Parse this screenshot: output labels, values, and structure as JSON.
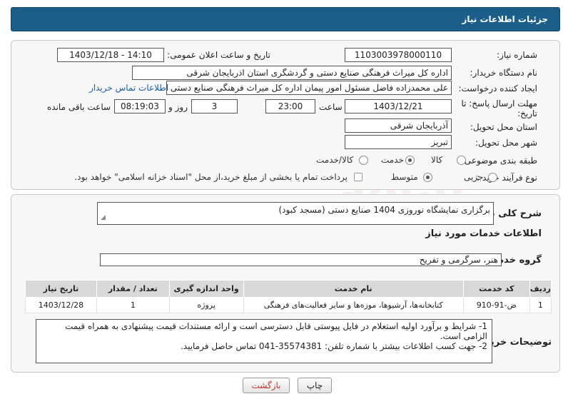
{
  "header": {
    "title": "جزئیات اطلاعات نیاز"
  },
  "fields": {
    "need_number_label": "شماره نیاز:",
    "need_number": "1103003978000110",
    "announce_label": "تاریخ و ساعت اعلان عمومی:",
    "announce_value": "1403/12/18 - 14:10",
    "buyer_label": "نام دستگاه خریدار:",
    "buyer_value": "اداره کل میراث فرهنگی  صنایع دستی و گردشگری استان اذربایجان شرقی",
    "creator_label": "ایجاد کننده درخواست:",
    "creator_value": "علی محمدزاده فاضل مسئول امور پیمان اداره کل میراث فرهنگی  صنایع دستی و",
    "contact_link": "اطلاعات تماس خریدار",
    "deadline_label_1": "مهلت ارسال پاسخ: تا",
    "deadline_label_2": "تاریخ:",
    "deadline_date": "1403/12/21",
    "time_label": "ساعت",
    "deadline_time": "23:00",
    "days_value": "3",
    "days_label": "روز و",
    "remaining_time": "08:19:03",
    "remaining_label": "ساعت باقی مانده",
    "province_label": "استان محل تحویل:",
    "province_value": "آذربایجان شرقی",
    "city_label": "شهر محل تحویل:",
    "city_value": "تبریز",
    "category_label": "طبقه بندی موضوعی:",
    "category_options": [
      "کالا",
      "خدمت",
      "کالا/خدمت"
    ],
    "category_selected": "خدمت",
    "process_label": "نوع فرآیند خرید :",
    "process_options": [
      "جزیی",
      "متوسط"
    ],
    "process_selected": "متوسط",
    "payment_note": "پرداخت تمام یا بخشی از مبلغ خرید،از محل \"اسناد خزانه اسلامی\" خواهد بود."
  },
  "summary": {
    "label": "شرح کلی نیاز:",
    "value": "برگزاری نمایشگاه نوروزی 1404 صنایع دستی (مسجد کبود)"
  },
  "services": {
    "section_title": "اطلاعات خدمات مورد نیاز",
    "group_label": "گروه خدمت:",
    "group_value": "هنر، سرگرمی و تفریح",
    "columns": [
      "ردیف",
      "کد خدمت",
      "نام خدمت",
      "واحد اندازه گیری",
      "تعداد / مقدار",
      "تاریخ نیاز"
    ],
    "rows": [
      [
        "1",
        "ض-91-910",
        "کتابخانه‌ها، آرشیوها، موزه‌ها و سایر فعالیت‌های فرهنگی",
        "پروژه",
        "1",
        "1403/12/28"
      ]
    ]
  },
  "notes": {
    "label": "توضیحات خریدار:",
    "line1": "1- شرایط و برآورد اولیه استعلام در فایل پیوستی قابل دسترسی است و ارائه مستندات قیمت پیشنهادی به همراه قیمت",
    "line2": "الزامی است.",
    "line3": "2- جهت کسب اطلاعات بیشتر  با شماره تلفن: 35574381-041  تماس حاصل فرمایید."
  },
  "buttons": {
    "print": "چاپ",
    "back": "بازگشت"
  },
  "watermark": "AriaTender.neT",
  "colors": {
    "header_bg": "#1b5e8a",
    "back_text": "#c0392b",
    "link": "#1a5ea8"
  }
}
